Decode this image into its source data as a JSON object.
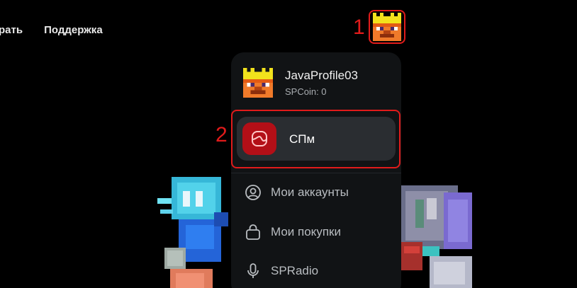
{
  "nav": {
    "items": [
      {
        "label": "рать"
      },
      {
        "label": "Поддержка"
      }
    ]
  },
  "annotations": {
    "step1": "1",
    "step2": "2",
    "highlight_color": "#e11b1b"
  },
  "user_menu": {
    "profile": {
      "name": "JavaProfile03",
      "coins": "SPCoin: 0",
      "avatar_icon": "crowned-pixel-face-icon"
    },
    "spm": {
      "label": "СПм",
      "icon": "spm-logo-icon",
      "accent": "#b30f17"
    },
    "items": [
      {
        "label": "Мои аккаунты",
        "icon": "user-circle-icon"
      },
      {
        "label": "Мои покупки",
        "icon": "shopping-bag-icon"
      },
      {
        "label": "SPRadio",
        "icon": "microphone-icon"
      }
    ]
  }
}
